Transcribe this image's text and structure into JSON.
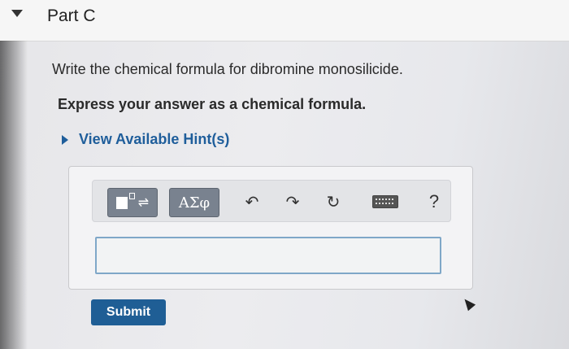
{
  "header": {
    "title": "Part C"
  },
  "question": {
    "text": "Write the chemical formula for dibromine monosilicide."
  },
  "instruction": {
    "text": "Express your answer as a chemical formula."
  },
  "hint": {
    "label": "View Available Hint(s)"
  },
  "toolbar": {
    "symbols_label": "ΑΣφ",
    "help_label": "?",
    "undo_icon": "↶",
    "redo_icon": "↷",
    "reset_icon": "↻",
    "templates_arrows": "⇌"
  },
  "answer_input": {
    "value": ""
  },
  "submit": {
    "label": "Submit"
  },
  "colors": {
    "accent": "#1f5e95",
    "hint": "#1f5e9b"
  }
}
